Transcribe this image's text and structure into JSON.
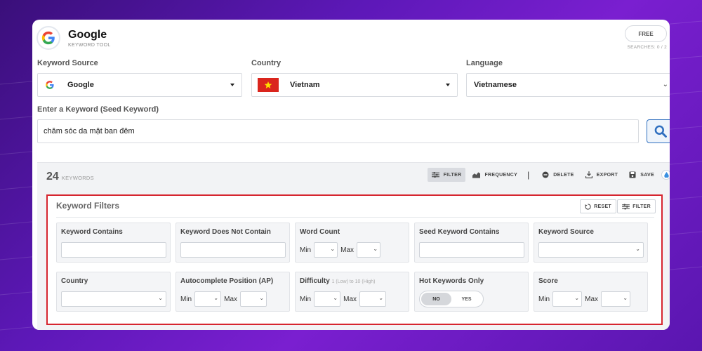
{
  "header": {
    "brand": "Google",
    "subtitle": "KEYWORD TOOL",
    "plan_badge": "FREE",
    "searches": "SEARCHES: 0 / 2"
  },
  "form": {
    "keyword_source": {
      "label": "Keyword Source",
      "value": "Google"
    },
    "country": {
      "label": "Country",
      "value": "Vietnam"
    },
    "language": {
      "label": "Language",
      "value": "Vietnamese"
    },
    "seed": {
      "label": "Enter a Keyword (Seed Keyword)",
      "value": "chăm sóc da mặt ban đêm"
    }
  },
  "results": {
    "count": "24",
    "count_label": "KEYWORDS",
    "toolbar": {
      "filter": "FILTER",
      "frequency": "FREQUENCY",
      "separator": "|",
      "delete": "DELETE",
      "export": "EXPORT",
      "save": "SAVE"
    }
  },
  "filters": {
    "title": "Keyword Filters",
    "reset": "RESET",
    "filter": "FILTER",
    "keyword_contains": "Keyword Contains",
    "keyword_not_contain": "Keyword Does Not Contain",
    "word_count": "Word Count",
    "seed_contains": "Seed Keyword Contains",
    "keyword_source": "Keyword Source",
    "country": "Country",
    "ap": "Autocomplete Position (AP)",
    "difficulty": "Difficulty",
    "difficulty_hint": "1 (Low) to 10 (High)",
    "hot_only": "Hot Keywords Only",
    "hot_no": "NO",
    "hot_yes": "YES",
    "score": "Score",
    "min": "Min",
    "max": "Max"
  },
  "icons": {
    "logo": "google-g-icon",
    "flag": "vietnam-flag-icon",
    "search": "magnifier-icon"
  },
  "colors": {
    "accent_red": "#d6252f",
    "search_blue": "#2f6fbf"
  }
}
